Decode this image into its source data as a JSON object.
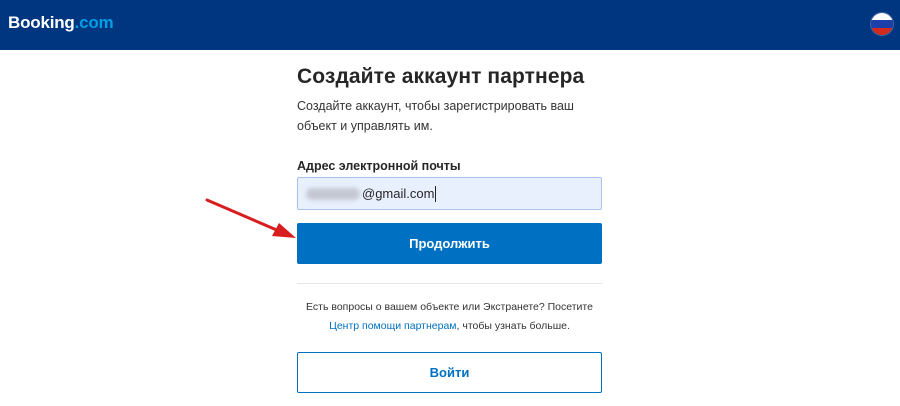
{
  "header": {
    "logo_part1": "Booking",
    "logo_part2": ".com",
    "language_icon": "russia-flag-icon"
  },
  "form": {
    "title": "Создайте аккаунт партнера",
    "subtitle": "Создайте аккаунт, чтобы зарегистрировать ваш объект и управлять им.",
    "email_label": "Адрес электронной почты",
    "email_value_visible": "@gmail.com",
    "continue_label": "Продолжить",
    "help_text_before": "Есть вопросы о вашем объекте или Экстранете? Посетите ",
    "help_link": "Центр помощи партнерам",
    "help_text_after": ", чтобы узнать больше.",
    "signin_label": "Войти"
  },
  "colors": {
    "header_bg": "#003580",
    "primary": "#0071c2",
    "logo_accent": "#009fe3",
    "arrow": "#d81e1e"
  }
}
